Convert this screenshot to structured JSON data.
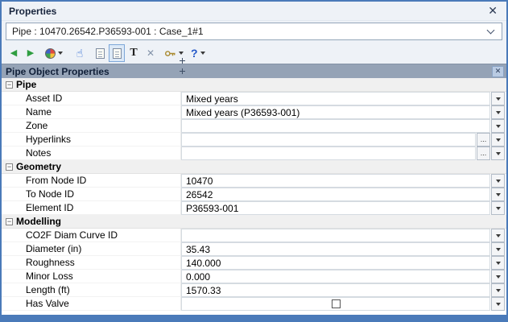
{
  "window": {
    "title": "Properties"
  },
  "selector": {
    "value": "Pipe : 10470.26542.P36593-001 : Case_1#1"
  },
  "toolbar": {
    "back": "◀",
    "forward": "▶",
    "hand": "☝",
    "text": "T",
    "clear": "✕",
    "help": "?"
  },
  "icons": {
    "close": "✕",
    "collapse": "−",
    "ellipsis": "..."
  },
  "panel": {
    "title": "Pipe Object Properties"
  },
  "groups": [
    {
      "label": "Pipe",
      "rows": [
        {
          "label": "Asset ID",
          "value": "Mixed years"
        },
        {
          "label": "Name",
          "value": "Mixed years (P36593-001)"
        },
        {
          "label": "Zone",
          "value": ""
        },
        {
          "label": "Hyperlinks",
          "value": ""
        },
        {
          "label": "Notes",
          "value": ""
        }
      ]
    },
    {
      "label": "Geometry",
      "rows": [
        {
          "label": "From Node ID",
          "value": "10470"
        },
        {
          "label": "To Node ID",
          "value": "26542"
        },
        {
          "label": "Element ID",
          "value": "P36593-001"
        }
      ]
    },
    {
      "label": "Modelling",
      "rows": [
        {
          "label": "CO2F Diam Curve ID",
          "value": ""
        },
        {
          "label": "Diameter (in)",
          "value": "35.43"
        },
        {
          "label": "Roughness",
          "value": "140.000"
        },
        {
          "label": "Minor Loss",
          "value": "0.000"
        },
        {
          "label": "Length (ft)",
          "value": "1570.33"
        },
        {
          "label": "Has Valve",
          "value": "",
          "checkbox": true,
          "checked": false
        }
      ]
    }
  ],
  "colors": {
    "window_border": "#4a7ab9",
    "panel_header": "#95a3b6",
    "group_row": "#f0f0f0",
    "back_forward_green": "#2f9e41"
  }
}
